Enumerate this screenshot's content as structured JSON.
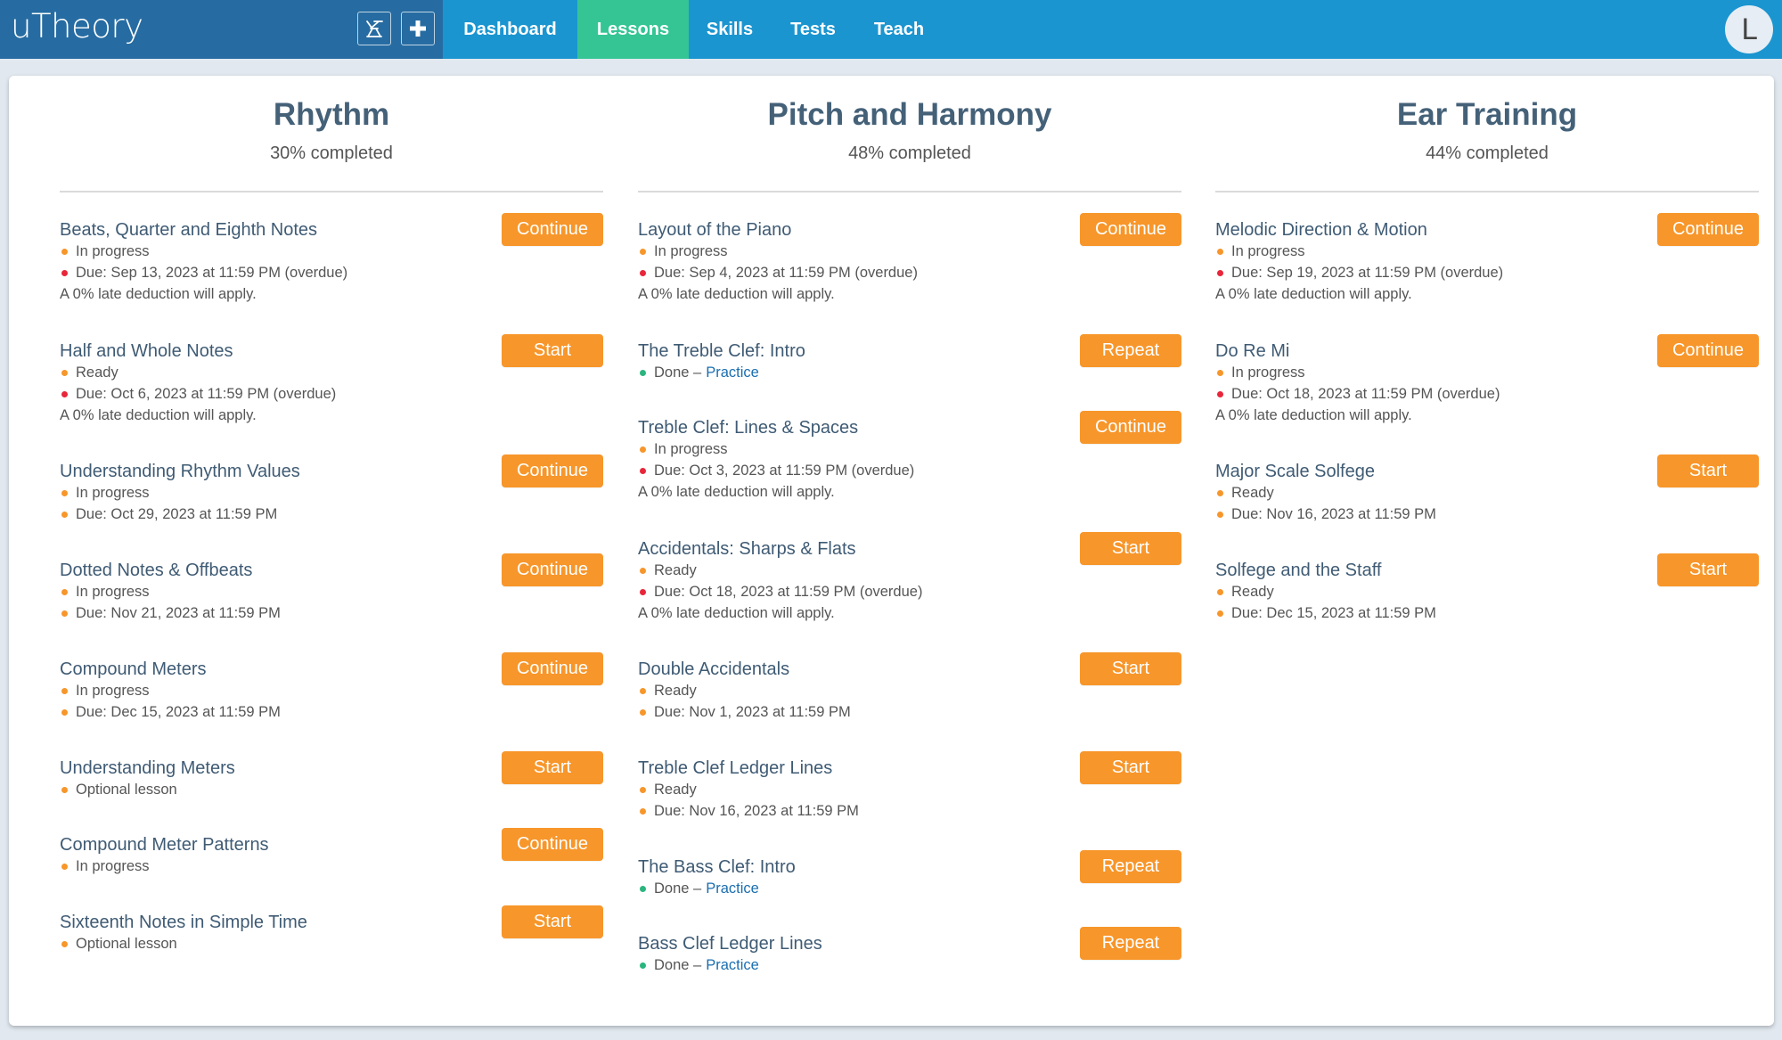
{
  "app": {
    "logo": "uTheory"
  },
  "header": {
    "icons": [
      {
        "name": "conductor-stand-icon"
      },
      {
        "name": "plus-icon"
      }
    ],
    "nav": [
      {
        "label": "Dashboard",
        "active": false
      },
      {
        "label": "Lessons",
        "active": true
      },
      {
        "label": "Skills",
        "active": false
      },
      {
        "label": "Tests",
        "active": false
      },
      {
        "label": "Teach",
        "active": false
      }
    ],
    "avatar_initial": "L"
  },
  "colors": {
    "brand_dark": "#266ca2",
    "nav_blue": "#1b95d0",
    "nav_active": "#35c595",
    "button_orange": "#f7962a",
    "dot_orange": "#f7962a",
    "dot_red": "#e8263a",
    "dot_green": "#2bb57e",
    "title_blue": "#3f5b74",
    "link_blue": "#1a6eb0"
  },
  "columns": [
    {
      "title": "Rhythm",
      "progress_percent": 30,
      "subtitle": "30% completed",
      "lessons": [
        {
          "title": "Beats, Quarter and Eighth Notes",
          "button": "Continue",
          "lines": [
            {
              "dot": "orange",
              "text": "In progress"
            },
            {
              "dot": "red",
              "text": "Due: Sep 13, 2023 at 11:59 PM (overdue)"
            },
            {
              "dot": null,
              "text": "A 0% late deduction will apply."
            }
          ]
        },
        {
          "title": "Half and Whole Notes",
          "button": "Start",
          "lines": [
            {
              "dot": "orange",
              "text": "Ready"
            },
            {
              "dot": "red",
              "text": "Due: Oct 6, 2023 at 11:59 PM (overdue)"
            },
            {
              "dot": null,
              "text": "A 0% late deduction will apply."
            }
          ]
        },
        {
          "title": "Understanding Rhythm Values",
          "button": "Continue",
          "lines": [
            {
              "dot": "orange",
              "text": "In progress"
            },
            {
              "dot": "orange",
              "text": "Due: Oct 29, 2023 at 11:59 PM"
            }
          ]
        },
        {
          "title": "Dotted Notes & Offbeats",
          "button": "Continue",
          "lines": [
            {
              "dot": "orange",
              "text": "In progress"
            },
            {
              "dot": "orange",
              "text": "Due: Nov 21, 2023 at 11:59 PM"
            }
          ]
        },
        {
          "title": "Compound Meters",
          "button": "Continue",
          "lines": [
            {
              "dot": "orange",
              "text": "In progress"
            },
            {
              "dot": "orange",
              "text": "Due: Dec 15, 2023 at 11:59 PM"
            }
          ]
        },
        {
          "title": "Understanding Meters",
          "button": "Start",
          "lines": [
            {
              "dot": "orange",
              "text": "Optional lesson"
            }
          ]
        },
        {
          "title": "Compound Meter Patterns",
          "button": "Continue",
          "lines": [
            {
              "dot": "orange",
              "text": "In progress"
            }
          ]
        },
        {
          "title": "Sixteenth Notes in Simple Time",
          "button": "Start",
          "lines": [
            {
              "dot": "orange",
              "text": "Optional lesson"
            }
          ]
        }
      ]
    },
    {
      "title": "Pitch and Harmony",
      "progress_percent": 48,
      "subtitle": "48% completed",
      "lessons": [
        {
          "title": "Layout of the Piano",
          "button": "Continue",
          "lines": [
            {
              "dot": "orange",
              "text": "In progress"
            },
            {
              "dot": "red",
              "text": "Due: Sep 4, 2023 at 11:59 PM (overdue)"
            },
            {
              "dot": null,
              "text": "A 0% late deduction will apply."
            }
          ]
        },
        {
          "title": "The Treble Clef: Intro",
          "button": "Repeat",
          "lines": [
            {
              "dot": "green",
              "text": "Done –",
              "link": "Practice"
            }
          ]
        },
        {
          "title": "Treble Clef: Lines & Spaces",
          "button": "Continue",
          "lines": [
            {
              "dot": "orange",
              "text": "In progress"
            },
            {
              "dot": "red",
              "text": "Due: Oct 3, 2023 at 11:59 PM (overdue)"
            },
            {
              "dot": null,
              "text": "A 0% late deduction will apply."
            }
          ]
        },
        {
          "title": "Accidentals: Sharps & Flats",
          "button": "Start",
          "lines": [
            {
              "dot": "orange",
              "text": "Ready"
            },
            {
              "dot": "red",
              "text": "Due: Oct 18, 2023 at 11:59 PM (overdue)"
            },
            {
              "dot": null,
              "text": "A 0% late deduction will apply."
            }
          ]
        },
        {
          "title": "Double Accidentals",
          "button": "Start",
          "lines": [
            {
              "dot": "orange",
              "text": "Ready"
            },
            {
              "dot": "orange",
              "text": "Due: Nov 1, 2023 at 11:59 PM"
            }
          ]
        },
        {
          "title": "Treble Clef Ledger Lines",
          "button": "Start",
          "lines": [
            {
              "dot": "orange",
              "text": "Ready"
            },
            {
              "dot": "orange",
              "text": "Due: Nov 16, 2023 at 11:59 PM"
            }
          ]
        },
        {
          "title": "The Bass Clef: Intro",
          "button": "Repeat",
          "lines": [
            {
              "dot": "green",
              "text": "Done –",
              "link": "Practice"
            }
          ]
        },
        {
          "title": "Bass Clef Ledger Lines",
          "button": "Repeat",
          "lines": [
            {
              "dot": "green",
              "text": "Done –",
              "link": "Practice"
            }
          ]
        }
      ]
    },
    {
      "title": "Ear Training",
      "progress_percent": 44,
      "subtitle": "44% completed",
      "lessons": [
        {
          "title": "Melodic Direction & Motion",
          "button": "Continue",
          "lines": [
            {
              "dot": "orange",
              "text": "In progress"
            },
            {
              "dot": "red",
              "text": "Due: Sep 19, 2023 at 11:59 PM (overdue)"
            },
            {
              "dot": null,
              "text": "A 0% late deduction will apply."
            }
          ]
        },
        {
          "title": "Do Re Mi",
          "button": "Continue",
          "lines": [
            {
              "dot": "orange",
              "text": "In progress"
            },
            {
              "dot": "red",
              "text": "Due: Oct 18, 2023 at 11:59 PM (overdue)"
            },
            {
              "dot": null,
              "text": "A 0% late deduction will apply."
            }
          ]
        },
        {
          "title": "Major Scale Solfege",
          "button": "Start",
          "lines": [
            {
              "dot": "orange",
              "text": "Ready"
            },
            {
              "dot": "orange",
              "text": "Due: Nov 16, 2023 at 11:59 PM"
            }
          ]
        },
        {
          "title": "Solfege and the Staff",
          "button": "Start",
          "lines": [
            {
              "dot": "orange",
              "text": "Ready"
            },
            {
              "dot": "orange",
              "text": "Due: Dec 15, 2023 at 11:59 PM"
            }
          ]
        }
      ]
    }
  ]
}
